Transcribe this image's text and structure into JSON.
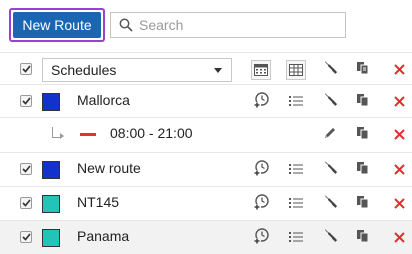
{
  "toolbar": {
    "new_route_label": "New Route",
    "search_placeholder": "Search",
    "search_value": ""
  },
  "header": {
    "dropdown_value": "Schedules",
    "checked": true
  },
  "rows": [
    {
      "name": "Mallorca",
      "color": "#1133cc",
      "checked": true
    },
    {
      "name": "New route",
      "color": "#1133cc",
      "checked": true
    },
    {
      "name": "NT145",
      "color": "#22c4b8",
      "checked": true
    },
    {
      "name": "Panama",
      "color": "#22c4b8",
      "checked": true
    }
  ],
  "schedule": {
    "time_range": "08:00 - 21:00",
    "dash_color": "#dd3333"
  },
  "colors": {
    "accent": "#1a66b3",
    "highlight_border": "#9b3fd4",
    "delete": "#e03030"
  },
  "icons": {
    "calendar": "calendar-icon",
    "grid": "grid-icon",
    "wrench": "wrench-icon",
    "copy": "copy-icon",
    "delete": "close-icon",
    "add_schedule": "add-schedule-icon",
    "list": "list-icon",
    "pencil": "pencil-icon"
  }
}
